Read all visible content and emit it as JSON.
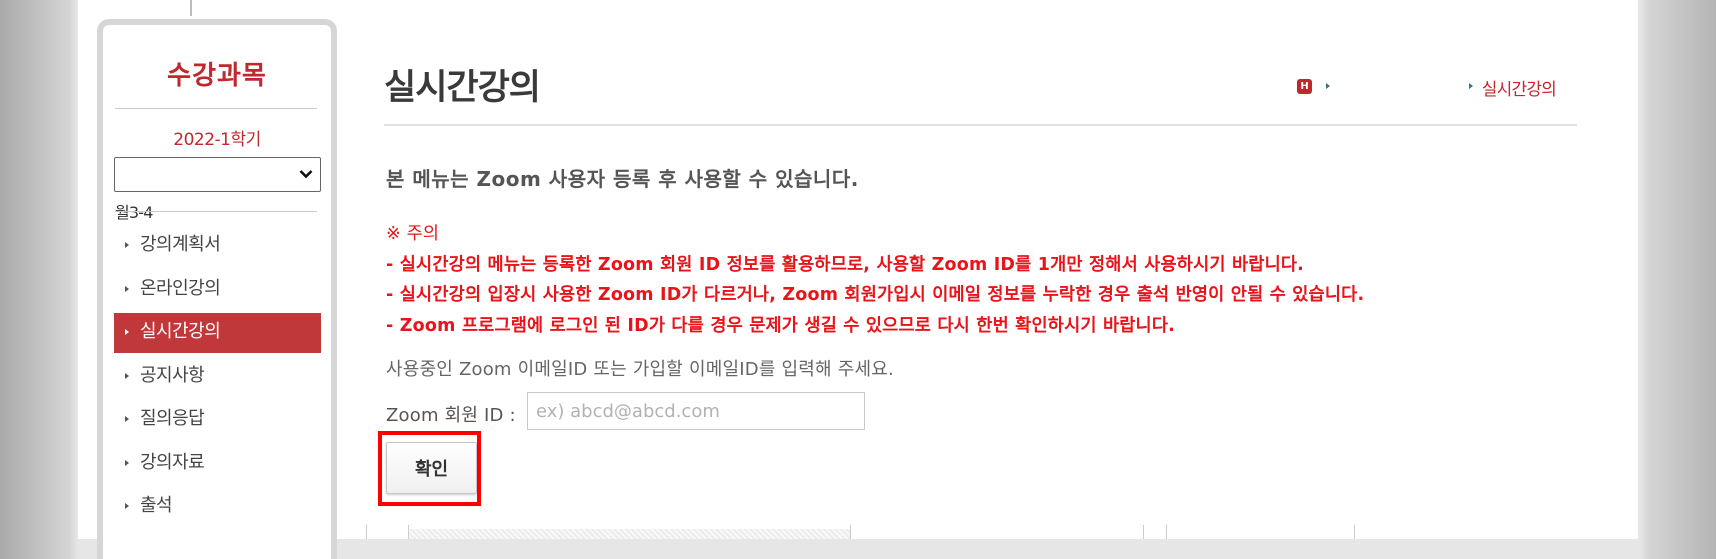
{
  "sidebar": {
    "title": "수강과목",
    "semester": "2022-1학기",
    "course_select_value": "",
    "time": "월3-4",
    "items": [
      {
        "label": "강의계획서",
        "active": false
      },
      {
        "label": "온라인강의",
        "active": false
      },
      {
        "label": "실시간강의",
        "active": true
      },
      {
        "label": "공지사항",
        "active": false
      },
      {
        "label": "질의응답",
        "active": false
      },
      {
        "label": "강의자료",
        "active": false
      },
      {
        "label": "출석",
        "active": false
      }
    ]
  },
  "header": {
    "title": "실시간강의",
    "breadcrumb": {
      "home_icon_text": "H",
      "current": "실시간강의"
    }
  },
  "content": {
    "notice_main": "본 메뉴는 Zoom 사용자 등록 후 사용할 수 있습니다.",
    "warning_head": "※ 주의",
    "warning_lines": [
      "- 실시간강의 메뉴는 등록한 Zoom 회원 ID 정보를 활용하므로, 사용할 Zoom ID를 1개만 정해서 사용하시기 바랍니다.",
      "- 실시간강의 입장시 사용한 Zoom ID가 다르거나, Zoom 회원가입시 이메일 정보를 누락한 경우 출석 반영이 안될 수 있습니다.",
      "- Zoom 프로그램에 로그인 된 ID가 다를 경우 문제가 생길 수 있으므로 다시 한번 확인하시기 바랍니다."
    ],
    "instruction": "사용중인 Zoom 이메일ID 또는 가입할 이메일ID를 입력해 주세요.",
    "id_label": "Zoom 회원 ID :",
    "id_input_value": "",
    "id_input_placeholder": "ex) abcd@abcd.com",
    "confirm_label": "확인"
  },
  "colors": {
    "accent": "#c1282e",
    "active_menu": "#c1383b",
    "warning": "#e8141a",
    "highlight": "#ff0000"
  }
}
